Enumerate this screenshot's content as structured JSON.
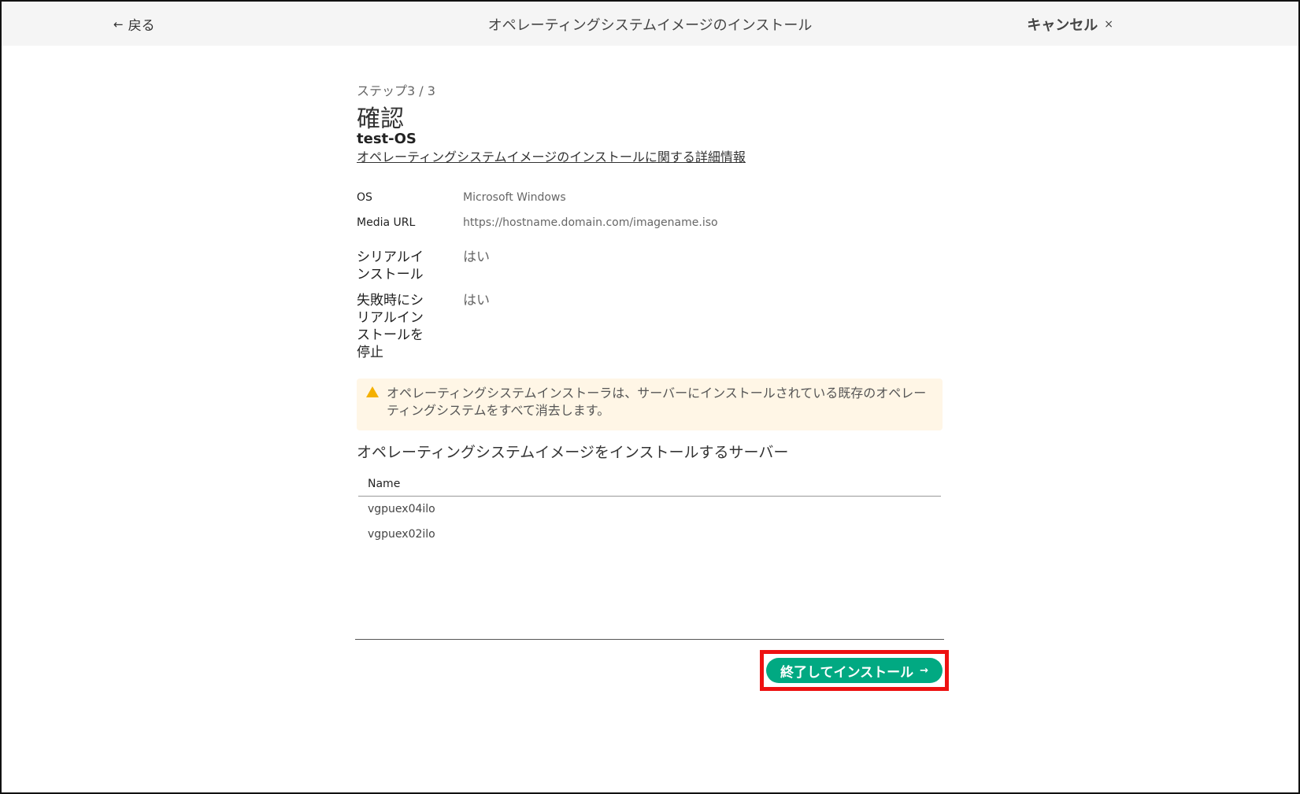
{
  "window": {
    "back_label": "戻る",
    "title": "オペレーティングシステムイメージのインストール",
    "cancel_label": "キャンセル",
    "cancel_icon": "×",
    "back_icon": "←"
  },
  "page": {
    "step": "ステップ3 / 3",
    "heading": "確認",
    "image_name": "test-OS",
    "info_link": "オペレーティングシステムイメージのインストールに関する詳細情報"
  },
  "details": [
    {
      "key": "OS",
      "value": "Microsoft Windows"
    },
    {
      "key": "Media URL",
      "value": "https://hostname.domain.com/imagename.iso"
    },
    {
      "key": "シリアルインストール",
      "value": "はい"
    },
    {
      "key": "失敗時にシリアルインストールを停止",
      "value": "はい"
    }
  ],
  "warning": {
    "text": "オペレーティングシステムインストーラは、サーバーにインストールされている既存のオペレーティングシステムをすべて消去します。",
    "color": "#f4b000"
  },
  "servers": {
    "heading": "オペレーティングシステムイメージをインストールするサーバー",
    "column": "Name",
    "rows": [
      "vgpuex04ilo",
      "vgpuex02ilo"
    ]
  },
  "actions": {
    "finish_label": "終了してインストール",
    "finish_icon": "→",
    "accent": "#01a982",
    "highlight_color": "#ee1111"
  }
}
